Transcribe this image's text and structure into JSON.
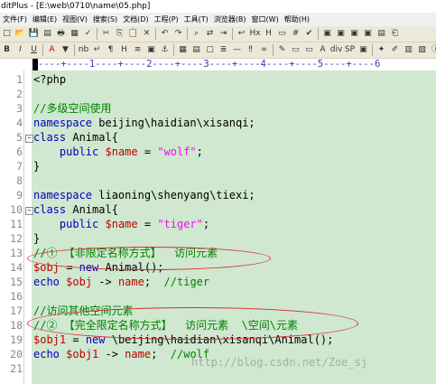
{
  "window": {
    "title": "ditPlus - [E:\\web\\0710\\name\\05.php]"
  },
  "menu": [
    "文件(F)",
    "编辑(E)",
    "视图(V)",
    "搜索(S)",
    "文档(D)",
    "工程(P)",
    "工具(T)",
    "浏览器(B)",
    "窗口(W)",
    "帮助(H)"
  ],
  "toolbar1": [
    "new-icon",
    "open-icon",
    "save-icon",
    "save-all-icon",
    "print-icon",
    "print-preview-icon",
    "spell-icon",
    "cut-icon",
    "copy-icon",
    "paste-icon",
    "delete-icon",
    "undo-icon",
    "redo-icon",
    "find-icon",
    "replace-icon",
    "goto-icon",
    "word-wrap-icon",
    "hex-icon",
    "html-icon",
    "ruler-icon",
    "line-number-icon",
    "check-icon",
    "window-a-icon",
    "window-b-icon",
    "window-c-icon",
    "window-d-icon",
    "directory-icon",
    "clip-icon"
  ],
  "toolbar2": [
    {
      "icon": "bold-icon",
      "glyph": "B"
    },
    {
      "icon": "italic-icon",
      "glyph": "I"
    },
    {
      "icon": "underline-icon",
      "glyph": "U"
    },
    {
      "icon": "font-color-icon",
      "glyph": "A"
    },
    {
      "icon": "highlight-icon",
      "glyph": "▼"
    },
    {
      "icon": "nbsp-icon",
      "glyph": "nb"
    },
    {
      "icon": "break-icon",
      "glyph": "↵"
    },
    {
      "icon": "paragraph-icon",
      "glyph": "¶"
    },
    {
      "icon": "heading-icon",
      "glyph": "H"
    },
    {
      "icon": "list-icon",
      "glyph": "≡"
    },
    {
      "icon": "image-icon",
      "glyph": "▣"
    },
    {
      "icon": "anchor-icon",
      "glyph": "⚓"
    },
    {
      "icon": "table-icon",
      "glyph": "▦"
    },
    {
      "icon": "form-icon",
      "glyph": "▤"
    },
    {
      "icon": "frame-icon",
      "glyph": "▢"
    },
    {
      "icon": "center-icon",
      "glyph": "≣"
    },
    {
      "icon": "rule-icon",
      "glyph": "—"
    },
    {
      "icon": "comment-icon",
      "glyph": "‼"
    },
    {
      "icon": "link-icon",
      "glyph": "∞"
    },
    {
      "icon": "style-icon",
      "glyph": "✎"
    },
    {
      "icon": "span-icon",
      "glyph": "▭"
    },
    {
      "icon": "button-icon",
      "glyph": "▭"
    },
    {
      "icon": "a-tag-icon",
      "glyph": "A"
    },
    {
      "icon": "div-icon",
      "glyph": "div"
    },
    {
      "icon": "sp-icon",
      "glyph": "SP"
    },
    {
      "icon": "script-icon",
      "glyph": "▣"
    },
    {
      "icon": "php-icon",
      "glyph": "✦"
    },
    {
      "icon": "brush-icon",
      "glyph": "✐"
    },
    {
      "icon": "hash-icon",
      "glyph": "▥"
    },
    {
      "icon": "color-icon",
      "glyph": "▧"
    },
    {
      "icon": "info-icon",
      "glyph": "ⓘ"
    }
  ],
  "ruler": {
    "text": "----+----1----+----2----+----3----+----4----+----5----+----6"
  },
  "code_lines": [
    {
      "n": "1",
      "fold": false,
      "parts": [
        {
          "c": "df",
          "t": "<?php"
        }
      ]
    },
    {
      "n": "2",
      "fold": false,
      "parts": []
    },
    {
      "n": "3",
      "fold": false,
      "parts": [
        {
          "c": "cm",
          "t": "//多级空间使用"
        }
      ]
    },
    {
      "n": "4",
      "fold": false,
      "parts": [
        {
          "c": "kw",
          "t": "namespace"
        },
        {
          "c": "df",
          "t": " beijing\\haidian\\xisanqi;"
        }
      ]
    },
    {
      "n": "5",
      "fold": true,
      "parts": [
        {
          "c": "kw",
          "t": "class"
        },
        {
          "c": "df",
          "t": " Animal{"
        }
      ]
    },
    {
      "n": "6",
      "fold": false,
      "parts": [
        {
          "c": "df",
          "t": "    "
        },
        {
          "c": "kw",
          "t": "public"
        },
        {
          "c": "df",
          "t": " "
        },
        {
          "c": "nm",
          "t": "$name"
        },
        {
          "c": "df",
          "t": " = "
        },
        {
          "c": "st",
          "t": "\"wolf\""
        },
        {
          "c": "df",
          "t": ";"
        }
      ]
    },
    {
      "n": "7",
      "fold": false,
      "parts": [
        {
          "c": "df",
          "t": "}"
        }
      ]
    },
    {
      "n": "8",
      "fold": false,
      "parts": []
    },
    {
      "n": "9",
      "fold": false,
      "parts": [
        {
          "c": "kw",
          "t": "namespace"
        },
        {
          "c": "df",
          "t": " liaoning\\shenyang\\tiexi;"
        }
      ]
    },
    {
      "n": "10",
      "fold": true,
      "parts": [
        {
          "c": "kw",
          "t": "class"
        },
        {
          "c": "df",
          "t": " Animal{"
        }
      ]
    },
    {
      "n": "11",
      "fold": false,
      "parts": [
        {
          "c": "df",
          "t": "    "
        },
        {
          "c": "kw",
          "t": "public"
        },
        {
          "c": "df",
          "t": " "
        },
        {
          "c": "nm",
          "t": "$name"
        },
        {
          "c": "df",
          "t": " = "
        },
        {
          "c": "st",
          "t": "\"tiger\""
        },
        {
          "c": "df",
          "t": ";"
        }
      ]
    },
    {
      "n": "12",
      "fold": false,
      "parts": [
        {
          "c": "df",
          "t": "}"
        }
      ]
    },
    {
      "n": "13",
      "fold": false,
      "parts": [
        {
          "c": "cm",
          "t": "//① 【非限定名称方式】  访问元素"
        }
      ]
    },
    {
      "n": "14",
      "fold": false,
      "parts": [
        {
          "c": "nm",
          "t": "$obj"
        },
        {
          "c": "df",
          "t": " = "
        },
        {
          "c": "kw",
          "t": "new"
        },
        {
          "c": "df",
          "t": " Animal();"
        }
      ]
    },
    {
      "n": "15",
      "fold": false,
      "parts": [
        {
          "c": "kw",
          "t": "echo"
        },
        {
          "c": "df",
          "t": " "
        },
        {
          "c": "nm",
          "t": "$obj"
        },
        {
          "c": "df",
          "t": " -> "
        },
        {
          "c": "nm",
          "t": "name"
        },
        {
          "c": "df",
          "t": ";  "
        },
        {
          "c": "cm",
          "t": "//tiger"
        }
      ]
    },
    {
      "n": "16",
      "fold": false,
      "parts": []
    },
    {
      "n": "17",
      "fold": false,
      "parts": [
        {
          "c": "cm",
          "t": "//访问其他空间元素"
        }
      ]
    },
    {
      "n": "18",
      "fold": false,
      "parts": [
        {
          "c": "cm",
          "t": "//② 【完全限定名称方式】  访问元素  \\空间\\元素"
        }
      ]
    },
    {
      "n": "19",
      "fold": false,
      "parts": [
        {
          "c": "nm",
          "t": "$obj1"
        },
        {
          "c": "df",
          "t": " = "
        },
        {
          "c": "kw",
          "t": "new"
        },
        {
          "c": "df",
          "t": " \\beijing\\haidian\\xisanqi\\Animal();"
        }
      ]
    },
    {
      "n": "20",
      "fold": false,
      "parts": [
        {
          "c": "kw",
          "t": "echo"
        },
        {
          "c": "df",
          "t": " "
        },
        {
          "c": "nm",
          "t": "$obj1"
        },
        {
          "c": "df",
          "t": " -> "
        },
        {
          "c": "nm",
          "t": "name"
        },
        {
          "c": "df",
          "t": ";  "
        },
        {
          "c": "cm",
          "t": "//wolf"
        }
      ]
    },
    {
      "n": "21",
      "fold": false,
      "parts": []
    }
  ],
  "watermark": "http://blog.csdn.net/Zoe_sj",
  "colors": {
    "editor_bg": "#cfe8cf",
    "keyword": "#0000c0",
    "variable": "#c00000",
    "comment": "#008000",
    "string": "#ff00ff",
    "annotation": "#d62d2d"
  }
}
